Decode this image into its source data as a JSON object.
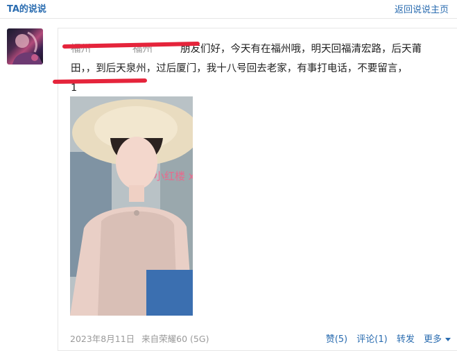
{
  "header": {
    "title": "TA的说说",
    "back_link": "返回说说主页"
  },
  "post": {
    "text_redacted_start": "福州",
    "text_redacted_mid": "福州",
    "text_line1": "朋友们好，今天有在福州哦，明天回福清宏路，后天莆",
    "text_line2": "田，，到后天泉州，过后厦门，我十八号回去老家，有事打电话，不要留言，",
    "text_line3": "1",
    "photo_watermark": "小红楼  xiaohonglou.link",
    "date": "2023年8月11日",
    "device": "来自荣耀60 (5G)"
  },
  "actions": {
    "like": "赞(5)",
    "comment": "评论(1)",
    "share": "转发",
    "more": "更多"
  },
  "colors": {
    "link": "#2a6cb0",
    "redaction": "#e5243b",
    "watermark": "#f0648a"
  }
}
